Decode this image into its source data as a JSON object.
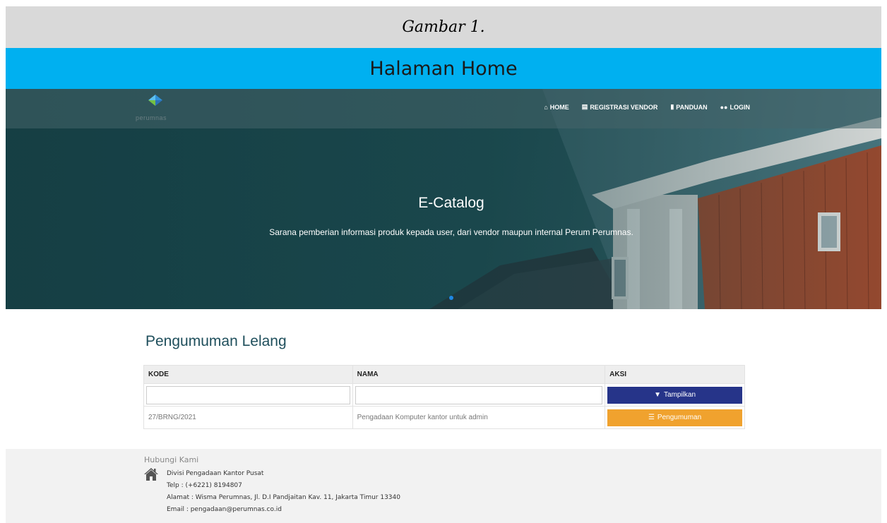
{
  "caption": "Gambar 1.",
  "figure_title": "Halaman Home",
  "brand": {
    "logo_text": "perumnas"
  },
  "nav": [
    {
      "icon": "home-icon",
      "label": "HOME"
    },
    {
      "icon": "id-card-icon",
      "label": "REGISTRASI VENDOR"
    },
    {
      "icon": "file-icon",
      "label": "PANDUAN"
    },
    {
      "icon": "users-icon",
      "label": "LOGIN"
    }
  ],
  "hero": {
    "title": "E-Catalog",
    "subtitle": "Sarana pemberian informasi produk kepada user, dari vendor maupun internal Perum Perumnas."
  },
  "pengumuman": {
    "title": "Pengumuman Lelang",
    "columns": [
      "KODE",
      "NAMA",
      "AKSI"
    ],
    "filter": {
      "kode_value": "",
      "nama_value": "",
      "button_label": "Tampilkan"
    },
    "rows": [
      {
        "kode": "27/BRNG/2021",
        "nama": "Pengadaan Komputer kantor untuk admin",
        "action_label": "Pengumuman"
      }
    ]
  },
  "footer": {
    "title": "Hubungi Kami",
    "lines": [
      "Divisi Pengadaan Kantor Pusat",
      "Telp : (+6221) 8194807",
      "Alamat : Wisma Perumnas, Jl. D.I Pandjaitan Kav. 11, Jakarta Timur 13340",
      "Email : pengadaan@perumnas.co.id"
    ]
  },
  "colors": {
    "caption_bg": "#d9d9d9",
    "title_bg": "#00b0f0",
    "primary_button": "#263489",
    "warning_button": "#f0a22e",
    "slider_dot": "#1e88e5"
  }
}
